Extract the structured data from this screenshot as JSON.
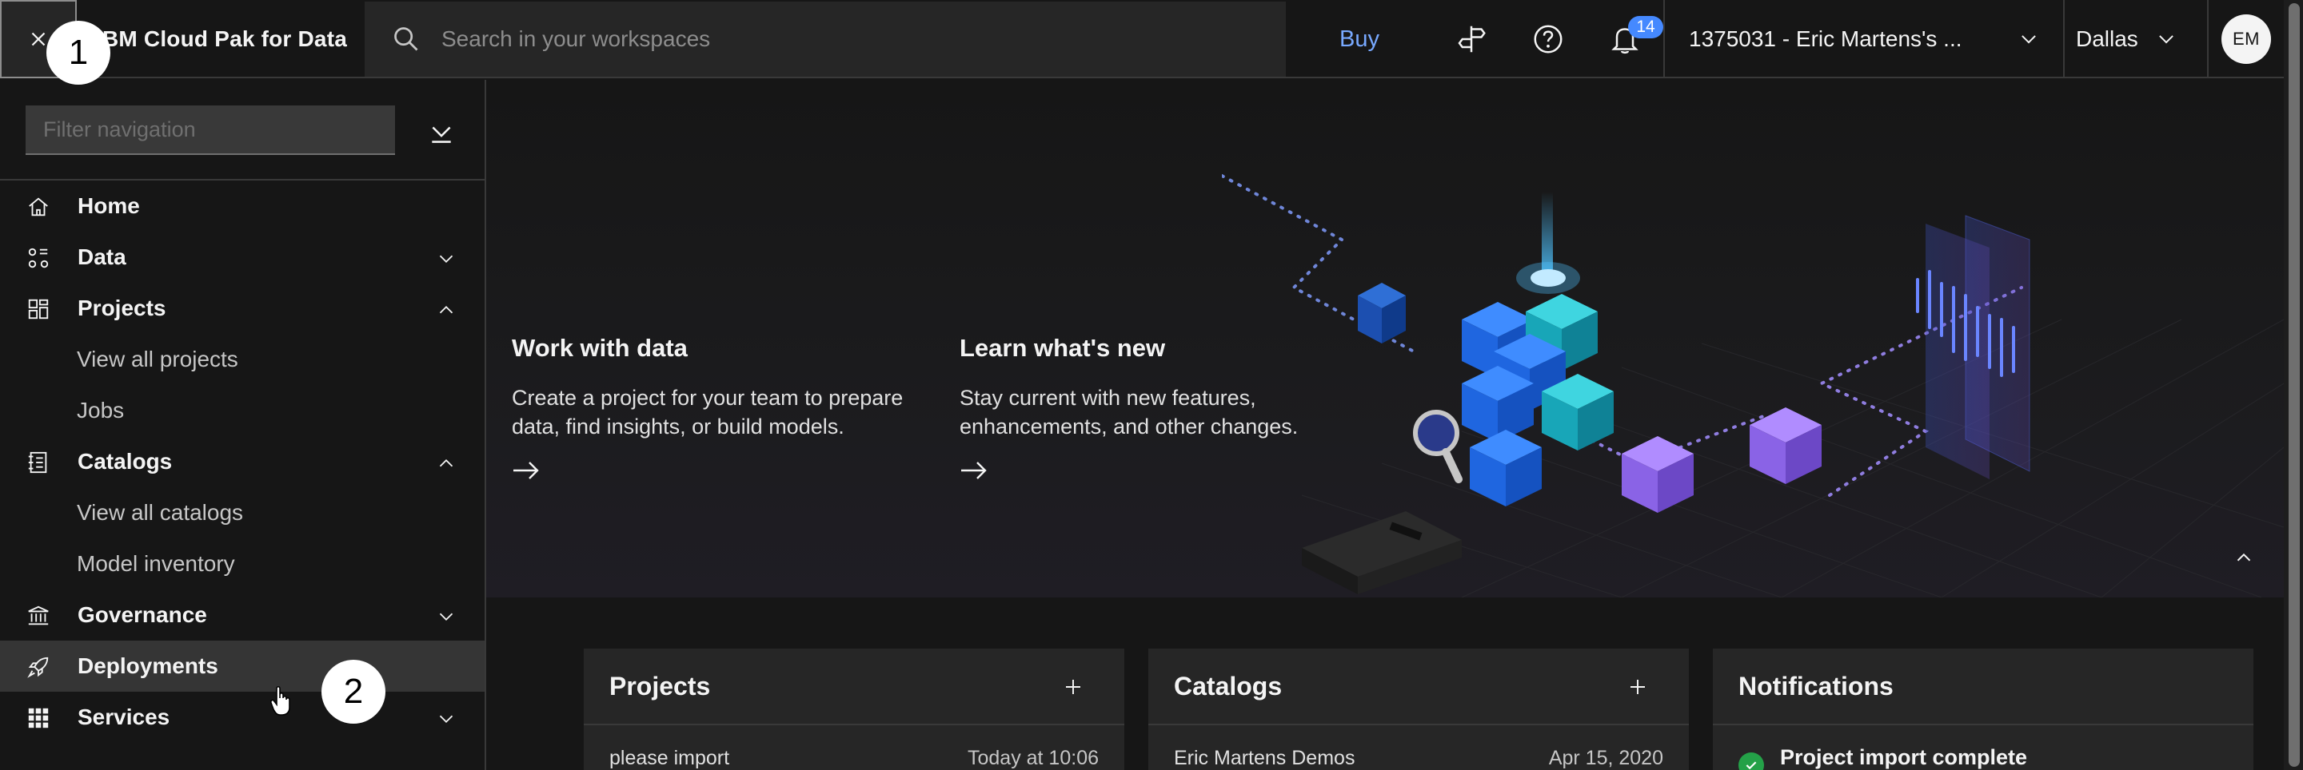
{
  "header": {
    "brand": "IBM Cloud Pak for Data",
    "search_placeholder": "Search in your workspaces",
    "buy_label": "Buy",
    "notification_count": "14",
    "account": "1375031 - Eric Martens's ...",
    "region": "Dallas",
    "avatar_initials": "EM"
  },
  "sidenav": {
    "filter_placeholder": "Filter navigation",
    "items": [
      {
        "label": "Home",
        "icon": "home-icon",
        "type": "top"
      },
      {
        "label": "Data",
        "icon": "data-icon",
        "type": "top",
        "chevron": "down"
      },
      {
        "label": "Projects",
        "icon": "projects-icon",
        "type": "top",
        "chevron": "up"
      },
      {
        "label": "View all projects",
        "type": "sub"
      },
      {
        "label": "Jobs",
        "type": "sub"
      },
      {
        "label": "Catalogs",
        "icon": "catalog-icon",
        "type": "top",
        "chevron": "up"
      },
      {
        "label": "View all catalogs",
        "type": "sub"
      },
      {
        "label": "Model inventory",
        "type": "sub"
      },
      {
        "label": "Governance",
        "icon": "governance-icon",
        "type": "top",
        "chevron": "down"
      },
      {
        "label": "Deployments",
        "icon": "rocket-icon",
        "type": "top",
        "active": true
      },
      {
        "label": "Services",
        "icon": "services-grid-icon",
        "type": "top",
        "chevron": "down"
      }
    ]
  },
  "hero": {
    "work_title": "Work with data",
    "work_text": "Create a project for your team to prepare data, find insights, or build models.",
    "learn_title": "Learn what's new",
    "learn_text": "Stay current with new features, enhancements, and other changes."
  },
  "tiles": {
    "projects": {
      "title": "Projects",
      "row_name": "please import",
      "row_date": "Today at 10:06"
    },
    "catalogs": {
      "title": "Catalogs",
      "row_name": "Eric Martens Demos",
      "row_date": "Apr 15, 2020"
    },
    "notifications": {
      "title": "Notifications",
      "row_text": "Project import complete"
    }
  },
  "markers": {
    "one": "1",
    "two": "2"
  },
  "colors": {
    "accent": "#78a9ff",
    "badge": "#4589ff",
    "success": "#24a148",
    "active_row": "#353535"
  }
}
